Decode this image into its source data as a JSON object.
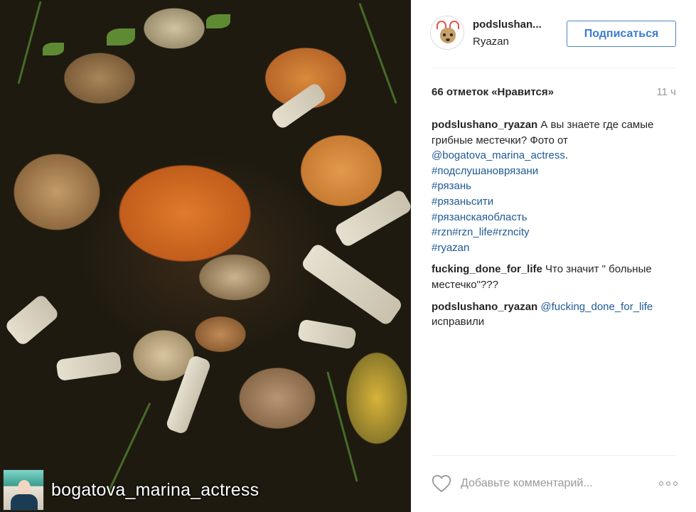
{
  "photo": {
    "alt_subject": "mushrooms",
    "caption_user": "bogatova_marina_actress"
  },
  "header": {
    "username": "podslushan...",
    "location": "Ryazan",
    "follow_label": "Подписаться"
  },
  "stats": {
    "likes": "66 отметок «Нравится»",
    "time": "11 ч"
  },
  "comments": [
    {
      "user": "podslushano_ryazan",
      "parts": [
        {
          "type": "text",
          "value": "А вы знаете где самые грибные местечки? Фото от "
        },
        {
          "type": "link",
          "value": "@bogatova_marina_actress"
        },
        {
          "type": "text",
          "value": ". "
        },
        {
          "type": "link",
          "value": "#подслушановрязани"
        },
        {
          "type": "br"
        },
        {
          "type": "link",
          "value": "#рязань"
        },
        {
          "type": "br"
        },
        {
          "type": "link",
          "value": "#рязаньсити"
        },
        {
          "type": "br"
        },
        {
          "type": "link",
          "value": "#рязанскаяобласть"
        },
        {
          "type": "br"
        },
        {
          "type": "link",
          "value": "#rzn#rzn_life#rzncity"
        },
        {
          "type": "br"
        },
        {
          "type": "link",
          "value": "#ryazan"
        }
      ]
    },
    {
      "user": "fucking_done_for_life",
      "parts": [
        {
          "type": "text",
          "value": "Что значит \" больные местечко\"???"
        }
      ]
    },
    {
      "user": "podslushano_ryazan",
      "parts": [
        {
          "type": "link",
          "value": "@fucking_done_for_life"
        },
        {
          "type": "text",
          "value": " исправили"
        }
      ]
    }
  ],
  "add_comment": {
    "placeholder": "Добавьте комментарий..."
  },
  "icons": {
    "like": "heart-icon",
    "more": "more-options-icon"
  },
  "colors": {
    "follow_blue": "#3b7bd1",
    "link_blue": "#1e5a96",
    "muted": "#999999"
  }
}
